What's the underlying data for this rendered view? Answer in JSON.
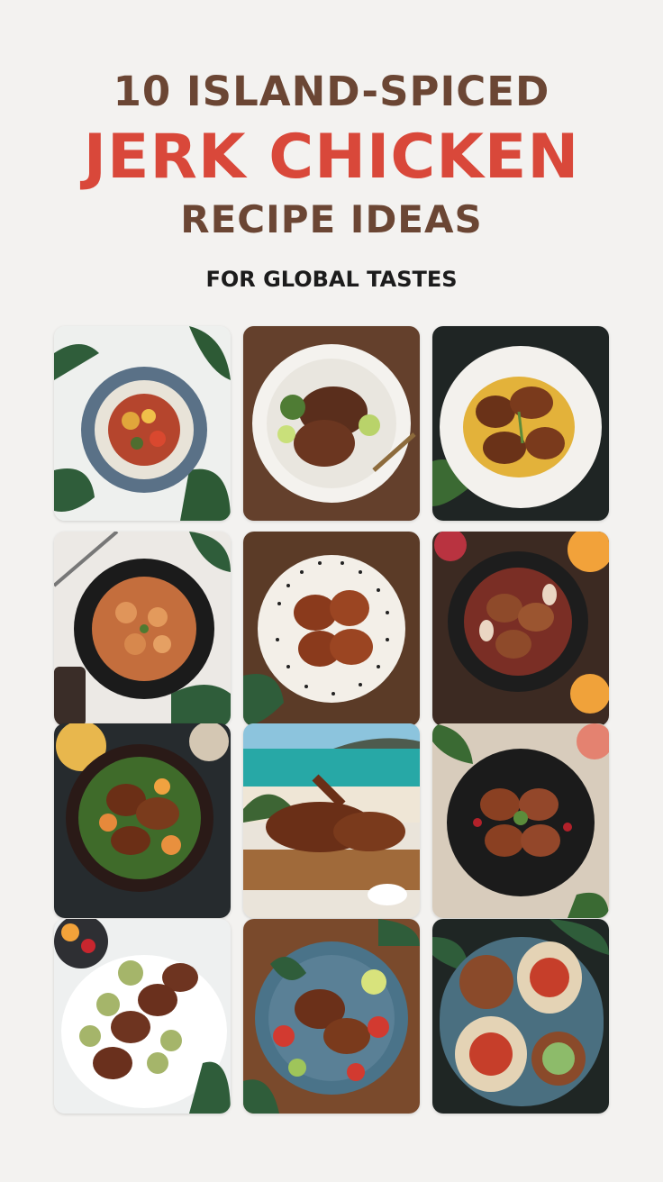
{
  "header": {
    "line1": "10 ISLAND-SPICED",
    "line2": "JERK CHICKEN",
    "line3": "RECIPE IDEAS",
    "subtitle": "FOR GLOBAL TASTES"
  },
  "colors": {
    "background": "#f3f2f0",
    "title_brown": "#6b4634",
    "title_red": "#d9483a",
    "subtitle": "#1c1c1c"
  },
  "gallery": {
    "tiles": [
      {
        "id": "tile-1",
        "description_icon": "plate-icon"
      },
      {
        "id": "tile-2",
        "description_icon": "plate-icon"
      },
      {
        "id": "tile-3",
        "description_icon": "plate-icon"
      },
      {
        "id": "tile-4",
        "description_icon": "plate-icon"
      },
      {
        "id": "tile-5",
        "description_icon": "plate-icon"
      },
      {
        "id": "tile-6",
        "description_icon": "plate-icon"
      },
      {
        "id": "tile-7",
        "description_icon": "plate-icon"
      },
      {
        "id": "tile-8",
        "description_icon": "plate-icon"
      },
      {
        "id": "tile-9",
        "description_icon": "plate-icon"
      },
      {
        "id": "tile-10",
        "description_icon": "plate-icon"
      },
      {
        "id": "tile-11",
        "description_icon": "plate-icon"
      },
      {
        "id": "tile-12",
        "description_icon": "plate-icon"
      }
    ]
  }
}
